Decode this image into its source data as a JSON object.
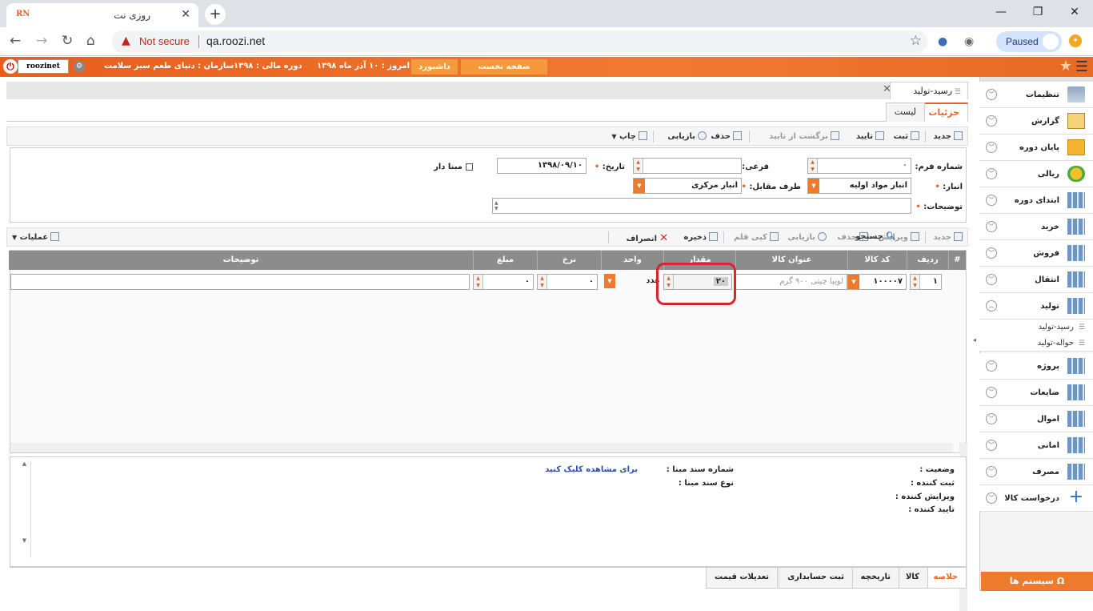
{
  "browser": {
    "tab_title": "روزی نت",
    "favicon_text": "RN",
    "new_tab": "+",
    "security": "Not secure",
    "url": "qa.roozi.net",
    "profile": "Paused"
  },
  "header": {
    "home": "صفحه نخست",
    "dashboard": "داشبورد",
    "today": "امروز : ۱۰ آذر ماه ۱۳۹۸",
    "fiscal": "دوره مالی : ۱۳۹۸",
    "org": "سازمان : دنیای طعم سبز سلامت",
    "username": "roozinet"
  },
  "sidebar": {
    "items": [
      {
        "label": "تنظیمات",
        "icon": "settings-folder-icon"
      },
      {
        "label": "گزارش",
        "icon": "report-clipboard-icon"
      },
      {
        "label": "پایان دوره",
        "icon": "end-period-icon"
      },
      {
        "label": "ریالی",
        "icon": "currency-icon"
      },
      {
        "label": "ابتدای دوره",
        "icon": "grid-star-icon"
      },
      {
        "label": "خرید",
        "icon": "grid-star-icon"
      },
      {
        "label": "فروش",
        "icon": "grid-star-icon"
      },
      {
        "label": "انتقال",
        "icon": "grid-star-icon"
      },
      {
        "label": "تولید",
        "icon": "grid-star-icon"
      }
    ],
    "subitems": [
      "رسید-تولید",
      "حواله-تولید"
    ],
    "items2": [
      {
        "label": "پروژه"
      },
      {
        "label": "ضایعات"
      },
      {
        "label": "اموال"
      },
      {
        "label": "امانی"
      },
      {
        "label": "مصرف"
      },
      {
        "label": "درخواست کالا"
      }
    ],
    "system_button": "سیستم ها"
  },
  "page": {
    "title": "رسید-تولید",
    "tabs": [
      "جزئیات",
      "لیست"
    ],
    "toolbar": [
      "جدید",
      "ثبت",
      "تایید",
      "برگشت از تایید",
      "حذف",
      "بازیابی",
      "چاپ"
    ]
  },
  "form": {
    "form_number_label": "شماره فرم:",
    "form_number_value": "۰",
    "sub_label": "فرعی:",
    "date_label": "تاریخ:",
    "date_value": "۱۳۹۸/۰۹/۱۰",
    "base_label": "مبنا دار",
    "warehouse_label": "انبار:",
    "warehouse_value": "انبار مواد اولیه",
    "counterparty_label": "طرف مقابل:",
    "counterparty_value": "انبار مرکزی",
    "notes_label": "توضیحات:"
  },
  "grid_toolbar": {
    "items": [
      "جدید",
      "ویرایش",
      "حذف",
      "بازیابی",
      "کپی قلم",
      "ذخیره",
      "انصراف"
    ],
    "search": "جستجو",
    "operations": "عملیات"
  },
  "grid": {
    "columns": [
      "#",
      "ردیف",
      "کد کالا",
      "عنوان کالا",
      "مقدار",
      "واحد",
      "نرخ",
      "مبلغ",
      "توضیحات"
    ],
    "row": {
      "index": "۱",
      "code": "۱۰۰۰۰۷",
      "title": "لوبیا چیتی ۹۰۰ گرم",
      "quantity": "۲۰",
      "unit": "عدد",
      "rate": "۰",
      "amount": "۰"
    }
  },
  "summary": {
    "status_label": "وضعیت :",
    "recorder_label": "ثبت کننده :",
    "editor_label": "ویرایش کننده :",
    "approver_label": "تایید کننده :",
    "base_doc_number_label": "شماره سند مبنا :",
    "base_doc_type_label": "نوع سند مبنا :",
    "view_link": "برای مشاهده کلیک کنید"
  },
  "bottom_tabs": [
    "خلاصه",
    "کالا",
    "تاریخچه",
    "ثبت حسابداری",
    "تعدیلات قیمت"
  ]
}
